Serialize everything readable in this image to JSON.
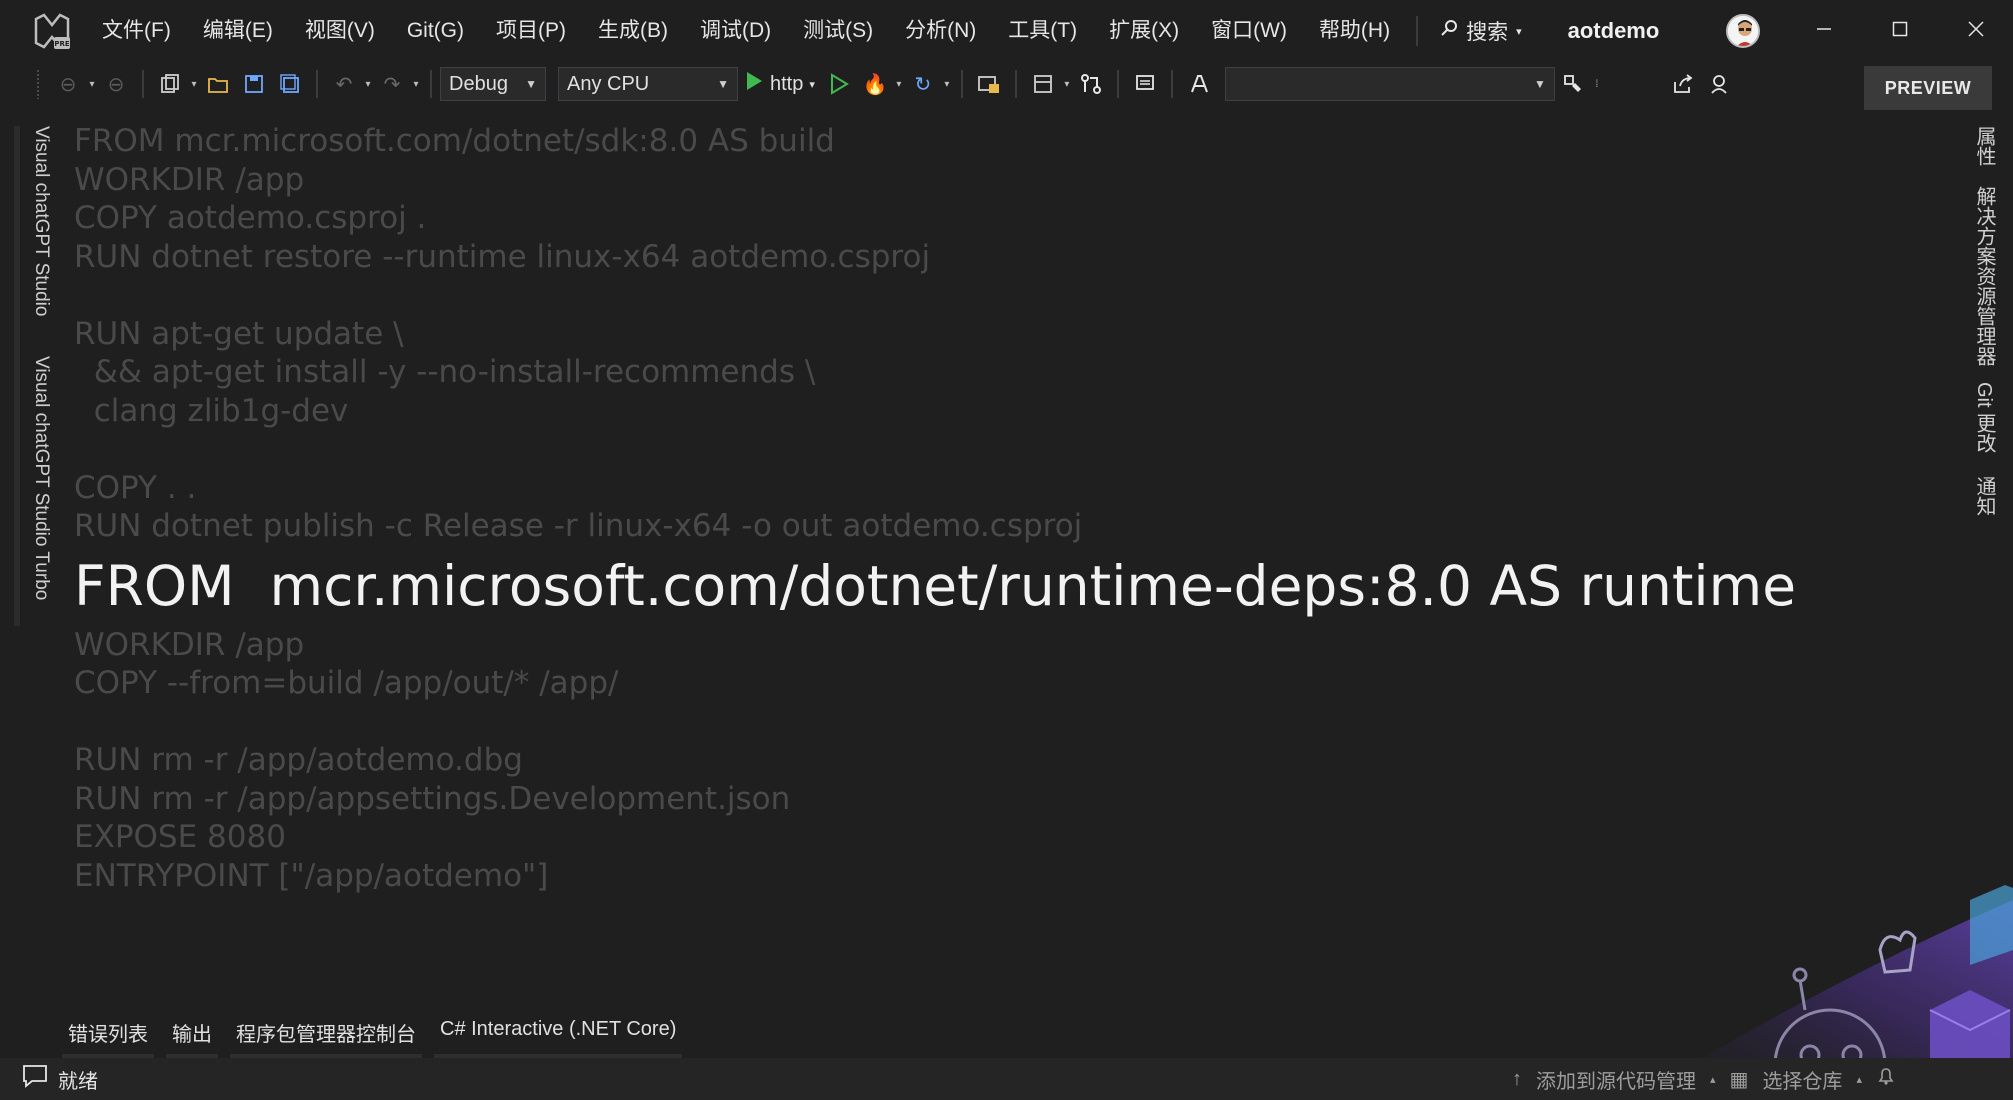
{
  "menu": {
    "items": [
      "文件(F)",
      "编辑(E)",
      "视图(V)",
      "Git(G)",
      "项目(P)",
      "生成(B)",
      "调试(D)",
      "测试(S)",
      "分析(N)",
      "工具(T)",
      "扩展(X)",
      "窗口(W)",
      "帮助(H)"
    ],
    "search_label": "搜索",
    "project_name": "aotdemo"
  },
  "toolbar": {
    "configuration": "Debug",
    "platform": "Any CPU",
    "run_target": "http",
    "preview_label": "PREVIEW"
  },
  "left_tabs": [
    "Visual chatGPT Studio",
    "Visual chatGPT Studio Turbo"
  ],
  "right_tabs": [
    "属性",
    "解决方案资源管理器",
    "Git 更改",
    "通知"
  ],
  "code_lines": [
    "FROM mcr.microsoft.com/dotnet/sdk:8.0 AS build",
    "WORKDIR /app",
    "COPY aotdemo.csproj .",
    "RUN dotnet restore --runtime linux-x64 aotdemo.csproj",
    "",
    "RUN apt-get update \\",
    "  && apt-get install -y --no-install-recommends \\",
    "  clang zlib1g-dev",
    "",
    "COPY . .",
    "RUN dotnet publish -c Release -r linux-x64 -o out aotdemo.csproj"
  ],
  "highlight_line": "FROM  mcr.microsoft.com/dotnet/runtime-deps:8.0 AS runtime",
  "code_lines_after": [
    "WORKDIR /app",
    "COPY --from=build /app/out/* /app/",
    "",
    "RUN rm -r /app/aotdemo.dbg",
    "RUN rm -r /app/appsettings.Development.json",
    "EXPOSE 8080",
    "ENTRYPOINT [\"/app/aotdemo\"]"
  ],
  "bottom_tabs": [
    "错误列表",
    "输出",
    "程序包管理器控制台",
    "C# Interactive (.NET Core)"
  ],
  "status": {
    "ready": "就绪",
    "add_to_source_control": "添加到源代码管理",
    "select_repository": "选择仓库"
  },
  "colors": {
    "background": "#1f1f1f",
    "accent_run": "#3fb950",
    "dim_code": "#4a4a4a",
    "highlight_code": "#f2f2f2"
  }
}
